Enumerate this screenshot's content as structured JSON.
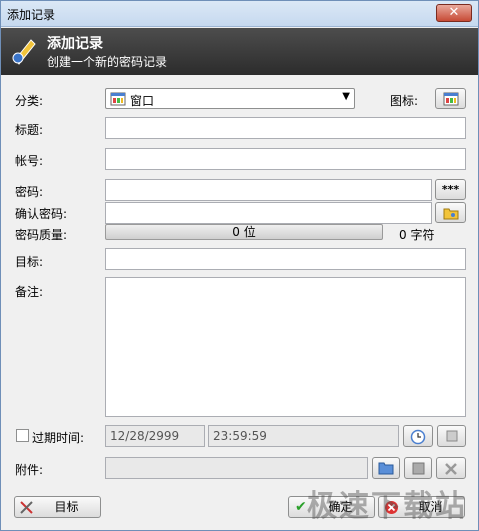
{
  "window": {
    "title": "添加记录",
    "close_label": "✕"
  },
  "banner": {
    "title": "添加记录",
    "subtitle": "创建一个新的密码记录"
  },
  "form": {
    "category_label": "分类:",
    "category_value": "窗口",
    "icon_label": "图标:",
    "title_label": "标题:",
    "account_label": "帐号:",
    "password_label": "密码:",
    "show_password_button": "***",
    "confirm_label": "确认密码:",
    "quality_label": "密码质量:",
    "quality_bits": "0 位",
    "quality_chars": "0 字符",
    "target_label": "目标:",
    "notes_label": "备注:",
    "expiry_label": "过期时间:",
    "expiry_date": "12/28/2999",
    "expiry_time": "23:59:59",
    "attachment_label": "附件:"
  },
  "buttons": {
    "target": "目标",
    "ok": "确定",
    "cancel": "取消"
  },
  "watermark": "极速下载站"
}
